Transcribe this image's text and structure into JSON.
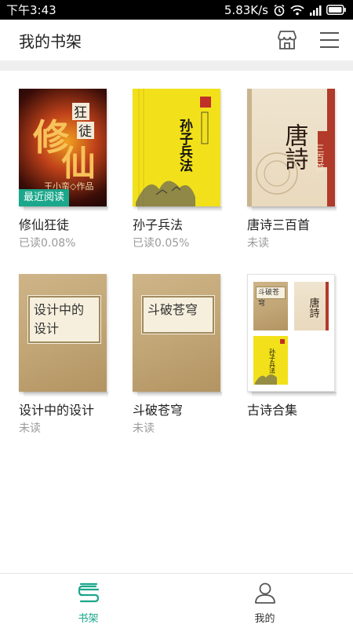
{
  "status_bar": {
    "time": "下午3:43",
    "speed": "5.83K/s"
  },
  "header": {
    "title": "我的书架",
    "store_icon": "store-icon",
    "menu_icon": "menu-icon"
  },
  "books": [
    {
      "title": "修仙狂徒",
      "progress": "已读0.08%",
      "badge": "最近阅读",
      "cover_text": {
        "big1": "修",
        "big2": "仙",
        "tag1": "狂",
        "tag2": "徒",
        "author": "王小蛮◇作品"
      }
    },
    {
      "title": "孙子兵法",
      "progress": "已读0.05%",
      "cover_text": {
        "main": "孙子兵法"
      }
    },
    {
      "title": "唐诗三百首",
      "progress": "未读",
      "cover_text": {
        "main": "唐詩",
        "side": "三百首"
      }
    },
    {
      "title": "设计中的设计",
      "progress": "未读",
      "cover_text": {
        "label": "设计中的设计"
      }
    },
    {
      "title": "斗破苍穹",
      "progress": "未读",
      "cover_text": {
        "label": "斗破苍穹"
      }
    },
    {
      "title": "古诗合集",
      "cover_text": {
        "mini1": "斗破苍穹",
        "mini2": "唐詩",
        "mini3": "孙子兵法"
      }
    }
  ],
  "tabs": [
    {
      "label": "书架",
      "icon": "bookshelf-icon",
      "active": true
    },
    {
      "label": "我的",
      "icon": "person-icon",
      "active": false
    }
  ],
  "colors": {
    "accent": "#1aa78b"
  }
}
